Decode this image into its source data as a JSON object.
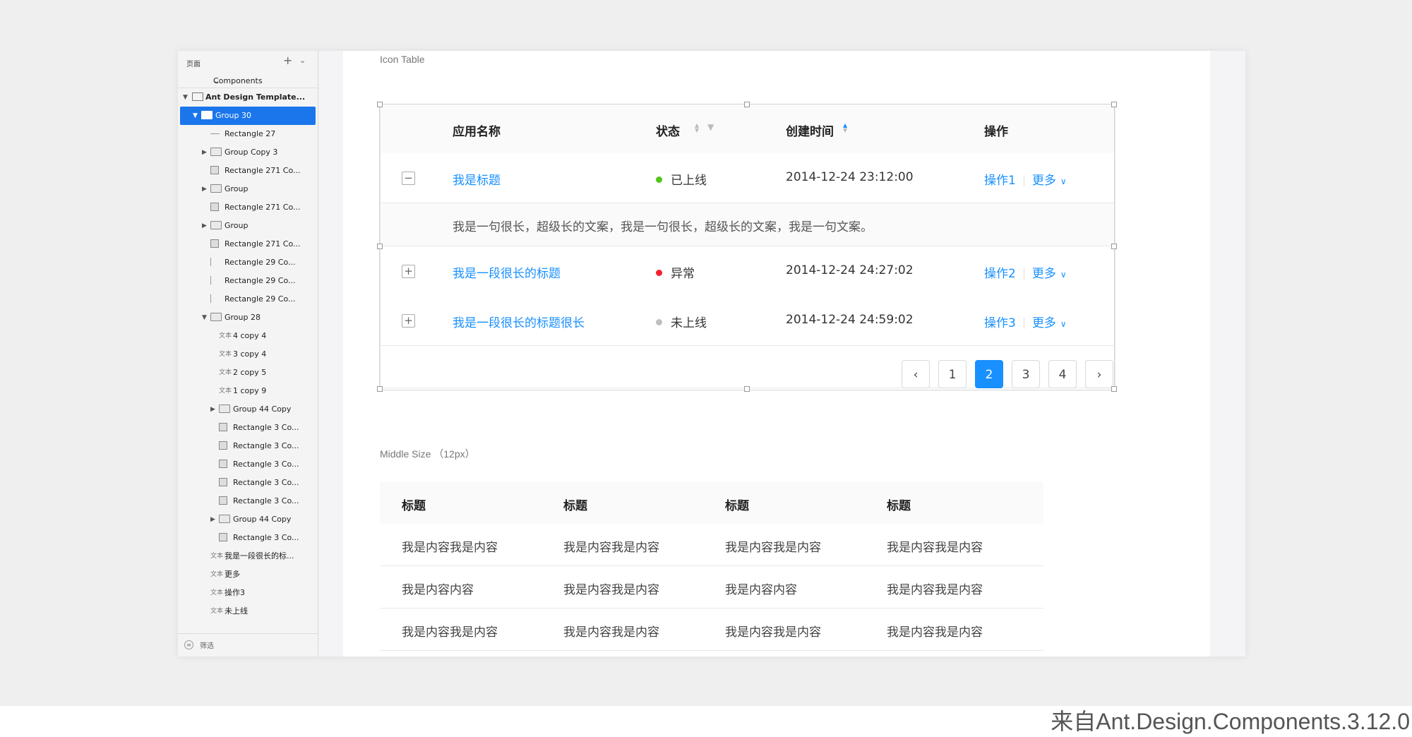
{
  "sidebar": {
    "pages_label": "页面",
    "components_label": "Components",
    "root": "Ant Design Template...",
    "layers": [
      {
        "label": "Group 30",
        "type": "folder",
        "indent": 1,
        "arrow": "down",
        "selected": true
      },
      {
        "label": "Rectangle 27",
        "type": "line-h",
        "indent": 2
      },
      {
        "label": "Group Copy 3",
        "type": "folder",
        "indent": 2,
        "arrow": "right"
      },
      {
        "label": "Rectangle 271 Co...",
        "type": "rect",
        "indent": 2
      },
      {
        "label": "Group",
        "type": "folder",
        "indent": 2,
        "arrow": "right"
      },
      {
        "label": "Rectangle 271 Co...",
        "type": "rect",
        "indent": 2
      },
      {
        "label": "Group",
        "type": "folder",
        "indent": 2,
        "arrow": "right"
      },
      {
        "label": "Rectangle 271 Co...",
        "type": "rect",
        "indent": 2
      },
      {
        "label": "Rectangle 29 Co...",
        "type": "line-v",
        "indent": 2
      },
      {
        "label": "Rectangle 29 Co...",
        "type": "line-v",
        "indent": 2
      },
      {
        "label": "Rectangle 29 Co...",
        "type": "line-v",
        "indent": 2
      },
      {
        "label": "Group 28",
        "type": "folder",
        "indent": 2,
        "arrow": "down"
      },
      {
        "label": "4 copy 4",
        "type": "text",
        "indent": 3
      },
      {
        "label": "3 copy 4",
        "type": "text",
        "indent": 3
      },
      {
        "label": "2 copy 5",
        "type": "text",
        "indent": 3
      },
      {
        "label": "1 copy 9",
        "type": "text",
        "indent": 3
      },
      {
        "label": "Group 44 Copy",
        "type": "folder",
        "indent": 3,
        "arrow": "right"
      },
      {
        "label": "Rectangle 3 Co...",
        "type": "rect",
        "indent": 3
      },
      {
        "label": "Rectangle 3 Co...",
        "type": "rect",
        "indent": 3
      },
      {
        "label": "Rectangle 3 Co...",
        "type": "rect",
        "indent": 3
      },
      {
        "label": "Rectangle 3 Co...",
        "type": "rect",
        "indent": 3
      },
      {
        "label": "Rectangle 3 Co...",
        "type": "rect",
        "indent": 3
      },
      {
        "label": "Group 44 Copy",
        "type": "folder",
        "indent": 3,
        "arrow": "right"
      },
      {
        "label": "Rectangle 3 Co...",
        "type": "rect",
        "indent": 3
      },
      {
        "label": "我是一段很长的标...",
        "type": "text",
        "indent": 2
      },
      {
        "label": "更多",
        "type": "text",
        "indent": 2
      },
      {
        "label": "操作3",
        "type": "text",
        "indent": 2
      },
      {
        "label": "未上线",
        "type": "text",
        "indent": 2
      }
    ],
    "text_icon": "文本",
    "filter_label": "筛选"
  },
  "icon_table": {
    "section_label": "Icon Table",
    "headers": [
      "应用名称",
      "状态",
      "创建时间",
      "操作"
    ],
    "rows": [
      {
        "name": "我是标题",
        "status": "已上线",
        "status_color": "#52c41a",
        "time": "2014-12-24  23:12:00",
        "action": "操作1",
        "more": "更多",
        "expand": "−"
      },
      {
        "name": "我是一段很长的标题",
        "status": "异常",
        "status_color": "#f5222d",
        "time": "2014-12-24  24:27:02",
        "action": "操作2",
        "more": "更多",
        "expand": "+"
      },
      {
        "name": "我是一段很长的标题很长",
        "status": "未上线",
        "status_color": "#bfbfbf",
        "time": "2014-12-24  24:59:02",
        "action": "操作3",
        "more": "更多",
        "expand": "+"
      }
    ],
    "expanded_text": "我是一句很长，超级长的文案，我是一句很长，超级长的文案，我是一句文案。",
    "pagination": {
      "pages": [
        "1",
        "2",
        "3",
        "4"
      ],
      "current": "2",
      "prev": "‹",
      "next": "›"
    }
  },
  "middle_table": {
    "section_label": "Middle Size （12px）",
    "headers": [
      "标题",
      "标题",
      "标题",
      "标题"
    ],
    "rows": [
      [
        "我是内容我是内容",
        "我是内容我是内容",
        "我是内容我是内容",
        "我是内容我是内容"
      ],
      [
        "我是内容内容",
        "我是内容我是内容",
        "我是内容内容",
        "我是内容我是内容"
      ],
      [
        "我是内容我是内容",
        "我是内容我是内容",
        "我是内容我是内容",
        "我是内容我是内容"
      ]
    ]
  },
  "footer_caption": "来自Ant.Design.Components.3.12.0",
  "colors": {
    "primary": "#1890ff",
    "selected_layer": "#1a76ea"
  }
}
